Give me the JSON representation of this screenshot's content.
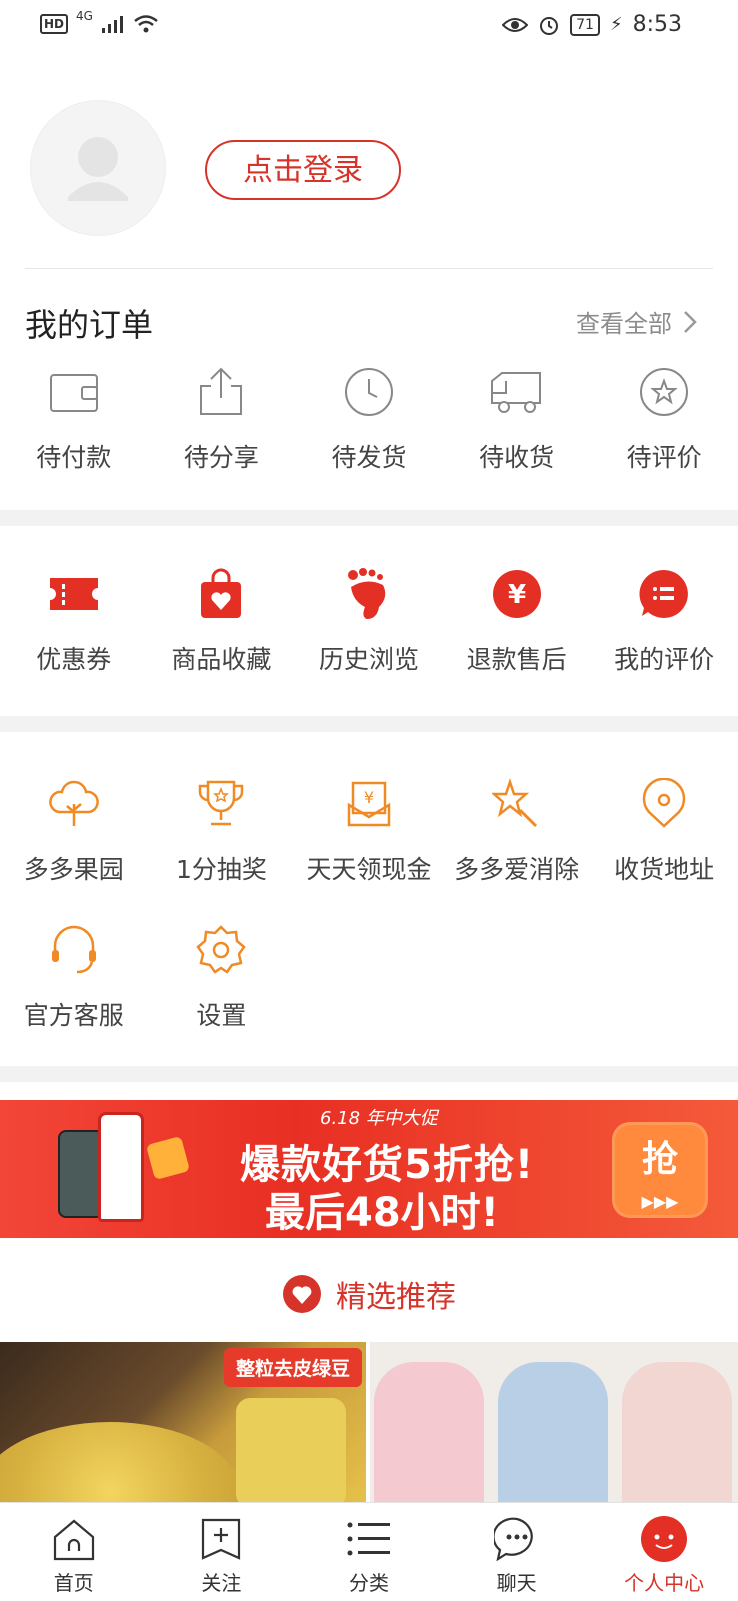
{
  "status_bar": {
    "hd": "HD",
    "network": "4G",
    "battery": "71",
    "time": "8:53"
  },
  "profile": {
    "login_label": "点击登录"
  },
  "orders": {
    "title": "我的订单",
    "view_all": "查看全部",
    "items": [
      {
        "label": "待付款",
        "icon": "wallet-icon"
      },
      {
        "label": "待分享",
        "icon": "share-icon"
      },
      {
        "label": "待发货",
        "icon": "clock-icon"
      },
      {
        "label": "待收货",
        "icon": "truck-icon"
      },
      {
        "label": "待评价",
        "icon": "star-review-icon"
      }
    ]
  },
  "quick": {
    "items": [
      {
        "label": "优惠券",
        "icon": "coupon-icon"
      },
      {
        "label": "商品收藏",
        "icon": "favorite-bag-icon"
      },
      {
        "label": "历史浏览",
        "icon": "footprint-icon"
      },
      {
        "label": "退款售后",
        "icon": "refund-icon"
      },
      {
        "label": "我的评价",
        "icon": "comment-icon"
      }
    ]
  },
  "services": {
    "row1": [
      {
        "label": "多多果园",
        "icon": "tree-icon"
      },
      {
        "label": "1分抽奖",
        "icon": "trophy-icon"
      },
      {
        "label": "天天领现金",
        "icon": "cash-envelope-icon"
      },
      {
        "label": "多多爱消除",
        "icon": "magic-star-icon"
      },
      {
        "label": "收货地址",
        "icon": "location-icon"
      }
    ],
    "row2": [
      {
        "label": "官方客服",
        "icon": "headset-icon"
      },
      {
        "label": "设置",
        "icon": "settings-icon"
      }
    ]
  },
  "banner": {
    "tag": "6.18 年中大促",
    "line1": "爆款好货5折抢!",
    "line2": "最后48小时!",
    "grab": "抢"
  },
  "featured": {
    "title": "精选推荐",
    "products": [
      {
        "label": "整粒去皮绿豆"
      }
    ]
  },
  "tabbar": {
    "items": [
      {
        "label": "首页",
        "icon": "home-icon",
        "active": false
      },
      {
        "label": "关注",
        "icon": "follow-icon",
        "active": false
      },
      {
        "label": "分类",
        "icon": "category-icon",
        "active": false
      },
      {
        "label": "聊天",
        "icon": "chat-icon",
        "active": false
      },
      {
        "label": "个人中心",
        "icon": "profile-icon",
        "active": true
      }
    ]
  },
  "colors": {
    "accent": "#d6342a",
    "orange": "#f08a24"
  }
}
